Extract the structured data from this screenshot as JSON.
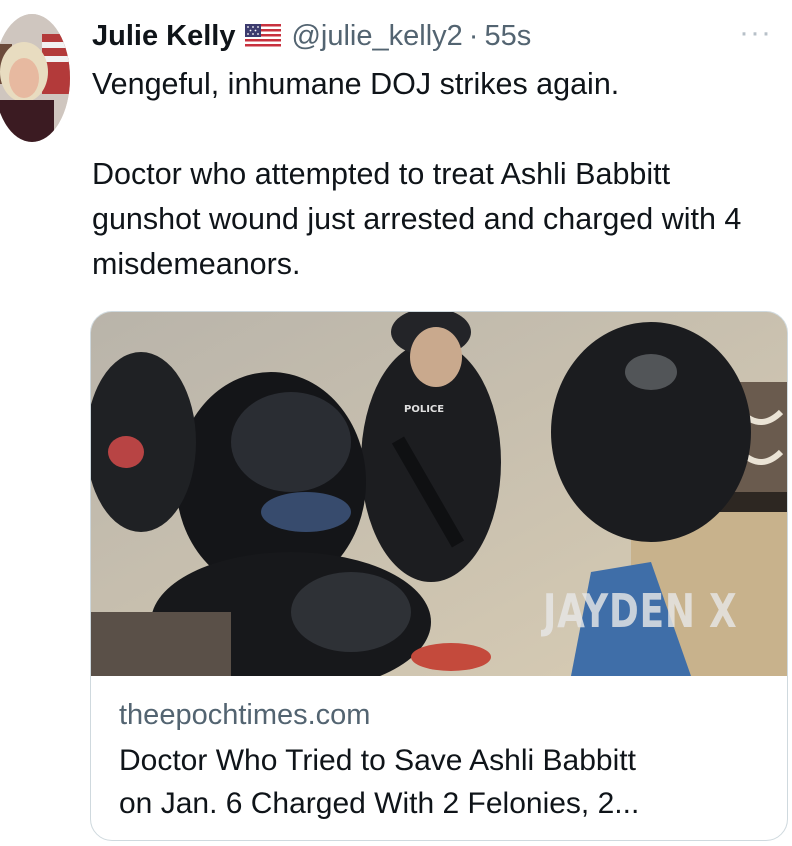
{
  "tweet": {
    "author": {
      "display_name": "Julie Kelly",
      "flag_icon": "us-flag-icon",
      "handle": "@julie_kelly2",
      "separator": "·",
      "time": "55s"
    },
    "more_icon": "more-horizontal-icon",
    "more_label": "···",
    "text": {
      "line1": "Vengeful, inhumane DOJ strikes again.",
      "line2": "Doctor who attempted to treat Ashli Babbitt gunshot wound just arrested and charged with 4 misdemeanors."
    },
    "card": {
      "image_watermark": "JAYDEN X",
      "image_label": "POLICE",
      "domain": "theepochtimes.com",
      "title_line1": "Doctor Who Tried to Save Ashli Babbitt",
      "title_line2": "on Jan. 6 Charged With 2 Felonies, 2..."
    }
  }
}
